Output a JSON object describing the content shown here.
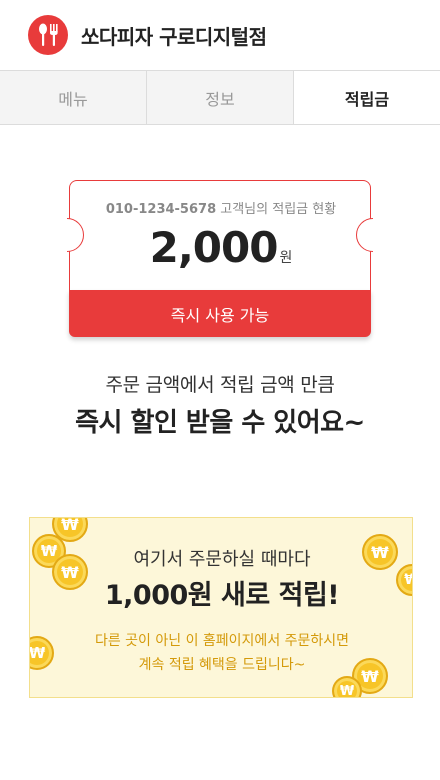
{
  "header": {
    "store_name": "쏘다피자 구로디지털점"
  },
  "tabs": [
    {
      "label": "메뉴"
    },
    {
      "label": "정보"
    },
    {
      "label": "적립금"
    }
  ],
  "ticket": {
    "phone": "010-1234-5678",
    "suffix": "고객님의 적립금 현황",
    "amount": "2,000",
    "unit": "원",
    "button_label": "즉시 사용 가능"
  },
  "message": {
    "line1": "주문 금액에서 적립 금액 만큼",
    "line2": "즉시 할인 받을 수 있어요~"
  },
  "banner": {
    "line1": "여기서 주문하실 때마다",
    "line2": "1,000원 새로 적립!",
    "line3": "다른 곳이 아닌 이 홈페이지에서 주문하시면",
    "line4": "계속 적립 혜택을 드립니다~",
    "coin_symbol": "₩"
  },
  "colors": {
    "accent": "#e83b3b",
    "banner_bg": "#fdf7d9",
    "banner_text": "#d49a0a",
    "coin": "#f7c528"
  },
  "icons": {
    "logo": "spoon-fork-icon"
  }
}
